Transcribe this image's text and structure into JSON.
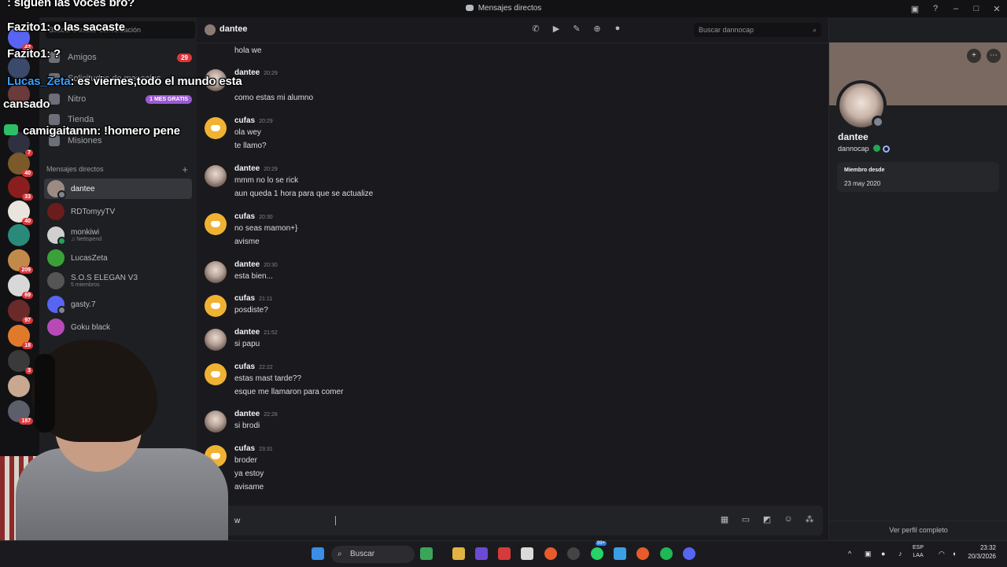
{
  "window": {
    "title": "Mensajes directos"
  },
  "nav": {
    "items": [
      {
        "label": "Buscar o iniciar conversación"
      },
      {
        "label": "Amigos",
        "count": "29"
      },
      {
        "label": "Solicitudes de mensajes"
      },
      {
        "label": "Nitro",
        "promo": "1 MES GRATIS"
      },
      {
        "label": "Tienda"
      },
      {
        "label": "Misiones"
      }
    ],
    "dm_header": "Mensajes directos",
    "dms": [
      {
        "name": "dantee",
        "sub": ""
      },
      {
        "name": "RDTomyyTV",
        "sub": ""
      },
      {
        "name": "monkiwi",
        "sub": "♫ Nettspend"
      },
      {
        "name": "LucasZeta",
        "sub": ""
      },
      {
        "name": "S.O.S ELEGAN V3",
        "sub": "5 miembros"
      },
      {
        "name": "gasty.7",
        "sub": ""
      },
      {
        "name": "Goku black",
        "sub": ""
      }
    ]
  },
  "server_badges": [
    "42",
    "7",
    "40",
    "33",
    "40",
    "209",
    "69",
    "97",
    "18",
    "3",
    "187"
  ],
  "chat": {
    "recipient": "dantee",
    "search_placeholder": "Buscar dannocap",
    "messages": [
      {
        "author": "",
        "time": "",
        "lines": [
          "hola we"
        ],
        "avatar": "none"
      },
      {
        "author": "dantee",
        "time": "20:29",
        "lines": [
          "como estas mi alumno"
        ],
        "avatar": "photo"
      },
      {
        "author": "cufas",
        "time": "20:29",
        "lines": [
          "ola wey",
          "te llamo?"
        ],
        "avatar": "discord"
      },
      {
        "author": "dantee",
        "time": "20:29",
        "lines": [
          "mmm no lo se rick",
          "aun queda 1 hora para que se actualize"
        ],
        "avatar": "photo"
      },
      {
        "author": "cufas",
        "time": "20:30",
        "lines": [
          "no seas mamon+}",
          "avisme"
        ],
        "avatar": "discord"
      },
      {
        "author": "dantee",
        "time": "20:30",
        "lines": [
          "esta bien..."
        ],
        "avatar": "photo"
      },
      {
        "author": "cufas",
        "time": "21:11",
        "lines": [
          "posdiste?"
        ],
        "avatar": "discord"
      },
      {
        "author": "dantee",
        "time": "21:52",
        "lines": [
          "si papu"
        ],
        "avatar": "photo"
      },
      {
        "author": "cufas",
        "time": "22:22",
        "lines": [
          "estas mast tarde??",
          "esque me llamaron para comer"
        ],
        "avatar": "discord"
      },
      {
        "author": "dantee",
        "time": "22:28",
        "lines": [
          "si brodi"
        ],
        "avatar": "photo"
      },
      {
        "author": "cufas",
        "time": "23:31",
        "lines": [
          "broder",
          "ya estoy",
          "avisame"
        ],
        "avatar": "discord"
      }
    ],
    "composer_value": "w"
  },
  "profile": {
    "display_name": "dantee",
    "username": "dannocap",
    "member_since_label": "Miembro desde",
    "member_since": "23 may 2020",
    "view_full": "Ver perfil completo"
  },
  "stream_chat": [
    {
      "user": "",
      "text": ": siguen las voces bro?",
      "color": "white"
    },
    {
      "user": "Fazito1",
      "text": ": o las sacaste",
      "color": "white"
    },
    {
      "user": "Fazito1",
      "text": ": ?",
      "color": "white"
    },
    {
      "user": "Lucas_Zeta",
      "text": ": es viernes,todo el mundo esta",
      "color": "blue"
    },
    {
      "user": "",
      "text": "cansado",
      "color": "white"
    },
    {
      "user": "camigaitannn",
      "text": ": !homero pene",
      "color": "white"
    }
  ],
  "taskbar": {
    "search": "Buscar",
    "lang1": "ESP",
    "lang2": "LAA",
    "time": "23:32",
    "date": "20/3/2026",
    "spotify_badge": "99+"
  }
}
